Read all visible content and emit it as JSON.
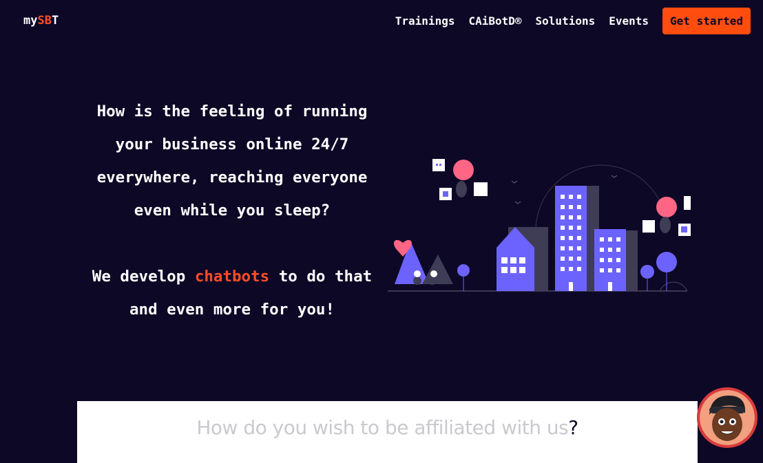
{
  "header": {
    "logo_prefix": "my",
    "logo_accent": "SB",
    "logo_suffix": "T",
    "nav": [
      "Trainings",
      "CAiBotD®",
      "Solutions",
      "Events"
    ],
    "cta_label": "Get started"
  },
  "hero": {
    "question": "How is the feeling of running your business online 24/7 everywhere, reaching everyone even while you sleep?",
    "statement_before": "We develop ",
    "statement_highlight": "chatbots",
    "statement_after": " to do that and even more for you!"
  },
  "panel": {
    "title": "How do you wish to be affiliated with us",
    "title_mark": "?"
  },
  "colors": {
    "background": "#0d0826",
    "accent": "#ff4d26",
    "cta": "#ff4d0f",
    "illustration_purple": "#6c5ce7"
  },
  "icons": [
    "city-illustration",
    "chat-avatar-icon"
  ]
}
